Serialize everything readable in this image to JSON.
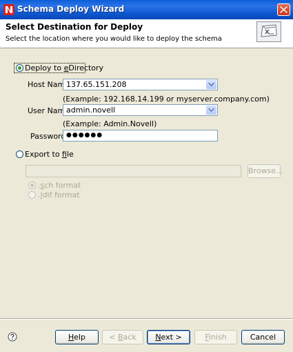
{
  "window": {
    "title": "Schema Deploy Wizard"
  },
  "header": {
    "title": "Select Destination for Deploy",
    "description": "Select the location where you would like to deploy the schema"
  },
  "deploy_option": {
    "label": "Deploy to eDirectory",
    "label_pre": "Deploy to ",
    "label_key": "e",
    "label_post": "Directory",
    "selected": true
  },
  "host": {
    "label": "Host Name:",
    "value": "137.65.151.208",
    "example": "(Example: 192.168.14.199 or myserver.company.com)"
  },
  "user": {
    "label": "User Name:",
    "value": "admin.novell",
    "example": "(Example:  Admin.Novell)"
  },
  "password": {
    "label": "Password:",
    "value": "●●●●●●"
  },
  "export_option": {
    "label_pre": "Export to ",
    "label_key": "f",
    "label_post": "ile",
    "selected": false
  },
  "file_path": {
    "value": ""
  },
  "browse_label": "Browse...",
  "formats": [
    {
      "label_pre": ".",
      "label_key": "s",
      "label_post": "ch format",
      "selected": true
    },
    {
      "label_pre": ".",
      "label_key": "l",
      "label_post": "dif format",
      "selected": false
    }
  ],
  "buttons": {
    "help": {
      "pre": "",
      "key": "H",
      "post": "elp"
    },
    "back": {
      "pre": "< ",
      "key": "B",
      "post": "ack"
    },
    "next": {
      "pre": "",
      "key": "N",
      "post": "ext >"
    },
    "finish": {
      "pre": "",
      "key": "F",
      "post": "inish"
    },
    "cancel": {
      "label": "Cancel"
    }
  },
  "colors": {
    "titlebar": "#0a5fd8",
    "dialog_bg": "#ece9d8",
    "button_border": "#003c74"
  }
}
